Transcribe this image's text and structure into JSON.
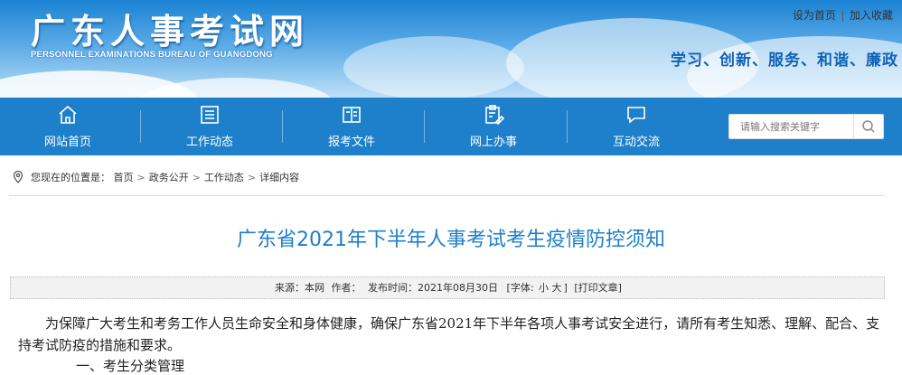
{
  "header": {
    "logo_title": "广东人事考试网",
    "logo_subtitle": "PERSONNEL EXAMINATIONS BUREAU OF GUANGDONG",
    "top_links": [
      "设为首页",
      "加入收藏"
    ],
    "slogan": "学习、创新、服务、和谐、廉政"
  },
  "nav": {
    "items": [
      {
        "label": "网站首页",
        "icon": "home-icon"
      },
      {
        "label": "工作动态",
        "icon": "list-icon"
      },
      {
        "label": "报考文件",
        "icon": "book-icon"
      },
      {
        "label": "网上办事",
        "icon": "clipboard-edit-icon"
      },
      {
        "label": "互动交流",
        "icon": "chat-icon"
      }
    ],
    "search_placeholder": "请输入搜索关键字"
  },
  "breadcrumb": {
    "prefix": "您现在的位置是：",
    "items": [
      "首页",
      "政务公开",
      "工作动态",
      "详细内容"
    ]
  },
  "article": {
    "title": "广东省2021年下半年人事考试考生疫情防控须知",
    "meta": {
      "source": "来源：本网",
      "author": "作者：",
      "date": "发布时间：2021年08月30日",
      "font_label": "[字体:",
      "font_small": "小",
      "font_large": "大",
      "font_end": "]",
      "print": "[打印文章]"
    },
    "paragraph1": "为保障广大考生和考务工作人员生命安全和身体健康，确保广东省2021年下半年各项人事考试安全进行，请所有考生知悉、理解、配合、支持考试防疫的措施和要求。",
    "paragraph2_partial": "一、考生分类管理"
  },
  "colors": {
    "nav_blue": "#1e7fca",
    "title_blue": "#1e7fca",
    "slogan_blue": "#1163b5"
  }
}
